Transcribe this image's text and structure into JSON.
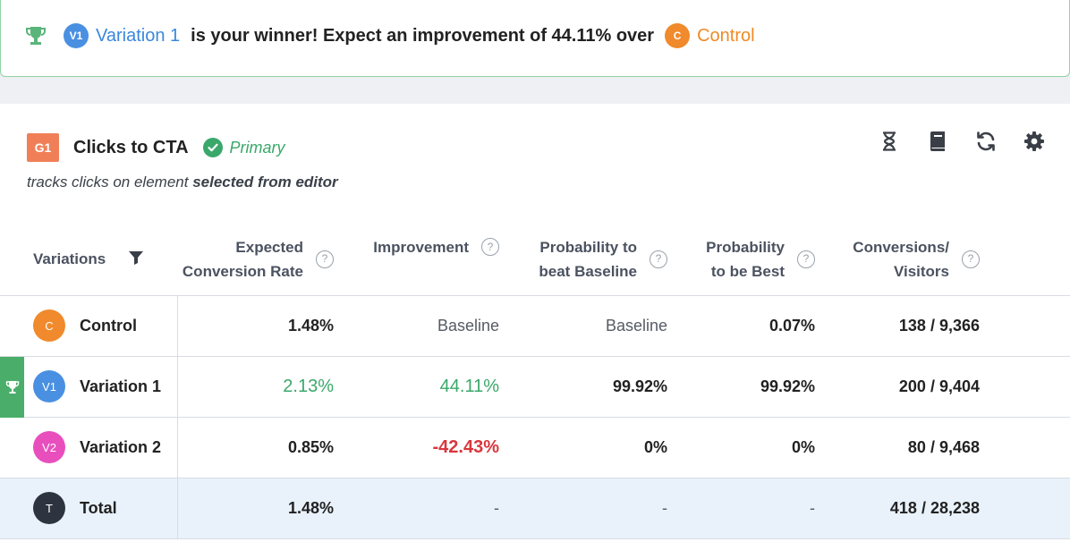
{
  "banner": {
    "winner_badge": "V1",
    "winner_name": "Variation 1",
    "message": "is your winner! Expect an improvement of 44.11% over",
    "control_badge": "C",
    "control_name": "Control",
    "trophy_icon": "trophy-icon"
  },
  "goal": {
    "tag": "G1",
    "title": "Clicks to CTA",
    "status": "Primary",
    "desc_prefix": "tracks clicks on element",
    "desc_emphasis": "selected from editor"
  },
  "toolbar": {
    "icons": [
      "hourglass-icon",
      "book-icon",
      "refresh-icon",
      "gear-icon"
    ]
  },
  "table": {
    "headers": {
      "variations": "Variations",
      "ecr_line1": "Expected",
      "ecr_line2": "Conversion Rate",
      "improvement": "Improvement",
      "pbb_line1": "Probability to",
      "pbb_line2": "beat Baseline",
      "pbest_line1": "Probability",
      "pbest_line2": "to be Best",
      "cv_line1": "Conversions/",
      "cv_line2": "Visitors",
      "help_glyph": "?"
    },
    "rows": [
      {
        "badge": "C",
        "name": "Control",
        "ecr": "1.48%",
        "improvement": "Baseline",
        "pbb": "Baseline",
        "pbest": "0.07%",
        "cv": "138 / 9,366"
      },
      {
        "badge": "V1",
        "name": "Variation 1",
        "ecr": "2.13%",
        "improvement": "44.11%",
        "pbb": "99.92%",
        "pbest": "99.92%",
        "cv": "200 / 9,404"
      },
      {
        "badge": "V2",
        "name": "Variation 2",
        "ecr": "0.85%",
        "improvement": "-42.43%",
        "pbb": "0%",
        "pbest": "0%",
        "cv": "80 / 9,468"
      },
      {
        "badge": "T",
        "name": "Total",
        "ecr": "1.48%",
        "improvement": "-",
        "pbb": "-",
        "pbest": "-",
        "cv": "418 / 28,238"
      }
    ]
  },
  "colors": {
    "accent_green": "#3aa86a",
    "accent_red": "#d9363e",
    "link_blue": "#3a87dd",
    "control_orange": "#ee8a26",
    "total_row_bg": "#e9f2fb"
  }
}
